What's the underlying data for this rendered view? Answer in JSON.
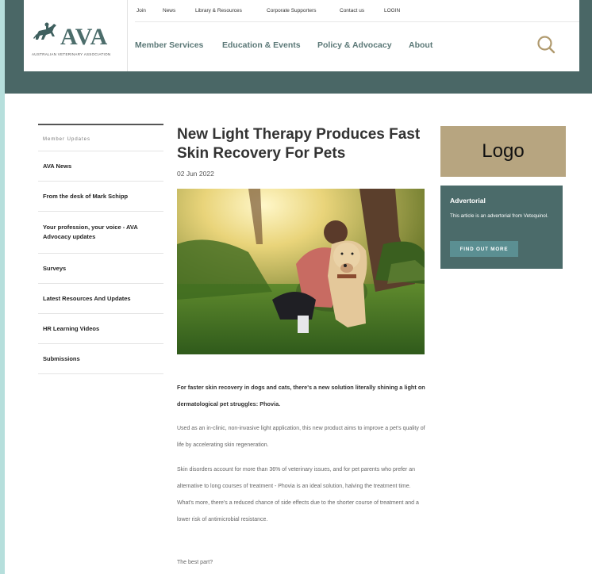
{
  "header": {
    "logo_text": "AVA",
    "logo_subtext": "AUSTRALIAN VETERINARY ASSOCIATION",
    "top_links": [
      "Join",
      "News",
      "Library & Resources",
      "Corporate Supporters",
      "Contact us",
      "LOGIN"
    ],
    "main_nav": [
      "Member Services",
      "Education & Events",
      "Policy & Advocacy",
      "About"
    ]
  },
  "sidebar": {
    "title": "Member Updates",
    "items": [
      {
        "label": "AVA News"
      },
      {
        "label": "From the desk of Mark Schipp"
      },
      {
        "label": "Your profession, your voice - AVA Advocacy updates"
      },
      {
        "label": "Surveys"
      },
      {
        "label": "Latest Resources And Updates"
      },
      {
        "label": "HR Learning Videos"
      },
      {
        "label": "Submissions"
      }
    ]
  },
  "article": {
    "title": "New Light Therapy Produces Fast Skin Recovery For Pets",
    "date": "02 Jun 2022",
    "lead": "For faster skin recovery in dogs and cats, there's a new solution literally shining a light on dermatological pet struggles: Phovia.",
    "paragraphs": [
      "Used as an in-clinic, non-invasive light application, this new product aims to improve a pet's quality of life by accelerating skin regeneration.",
      "Skin disorders account for more than 36% of veterinary issues, and for pet parents who prefer an alternative to long courses of treatment - Phovia is an ideal solution, halving the treatment time. What's more, there's a reduced chance of side effects due to the shorter course of treatment and a lower risk of antimicrobial resistance.",
      "The best part?"
    ]
  },
  "aside": {
    "logo_placeholder": "Logo",
    "advert_title": "Advertorial",
    "advert_text": "This article is an advertorial from Vetoquinol.",
    "advert_button": "FIND OUT MORE"
  }
}
